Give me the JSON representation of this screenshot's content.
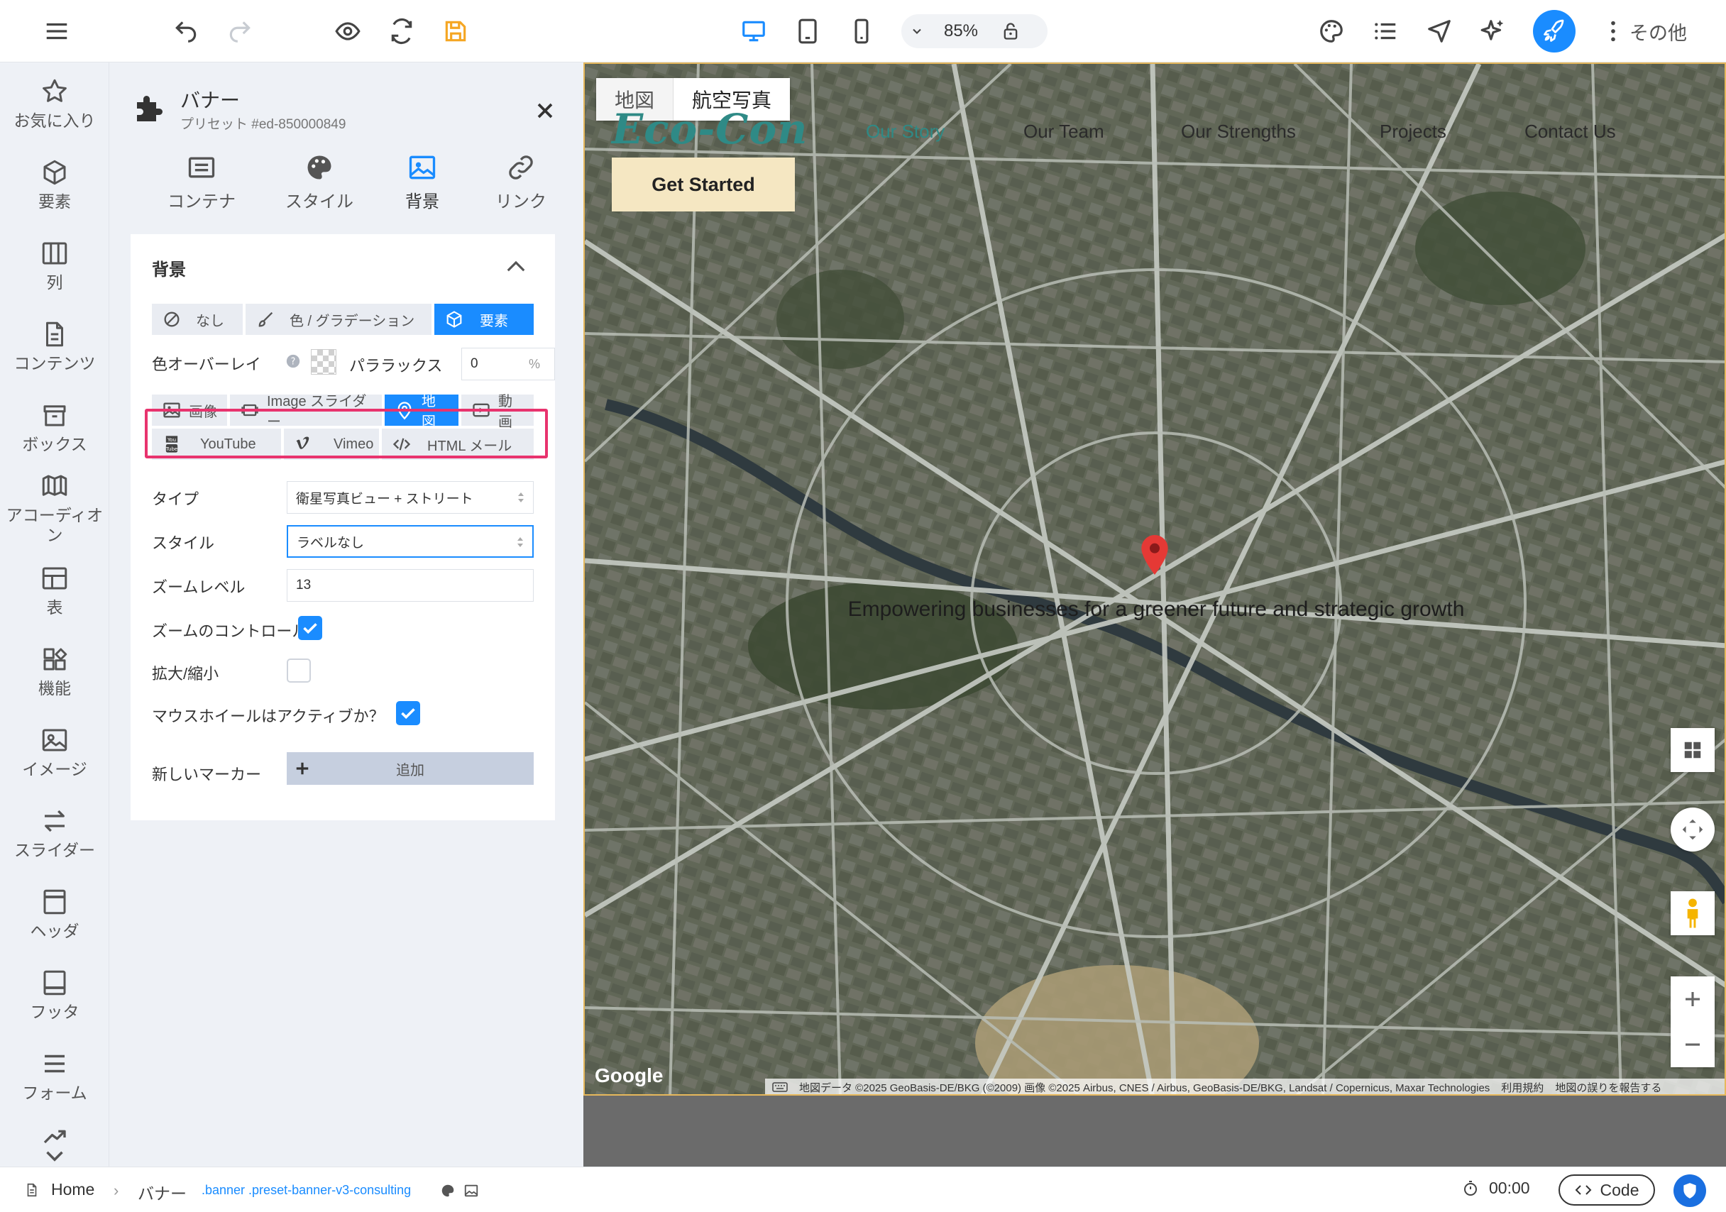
{
  "toolbar": {
    "zoom": "85%",
    "more_label": "その他"
  },
  "rail": {
    "items": [
      {
        "label": "お気に入り"
      },
      {
        "label": "要素"
      },
      {
        "label": "列"
      },
      {
        "label": "コンテンツ"
      },
      {
        "label": "ボックス"
      },
      {
        "label": "アコーディオ",
        "label2": "ン"
      },
      {
        "label": "表"
      },
      {
        "label": "機能"
      },
      {
        "label": "イメージ"
      },
      {
        "label": "スライダー"
      },
      {
        "label": "ヘッダ"
      },
      {
        "label": "フッタ"
      },
      {
        "label": "フォーム"
      }
    ]
  },
  "panel": {
    "title": "バナー",
    "subtitle": "プリセット #ed-850000849",
    "tabs": [
      {
        "label": "コンテナ"
      },
      {
        "label": "スタイル"
      },
      {
        "label": "背景"
      },
      {
        "label": "リンク"
      }
    ],
    "section_title": "背景",
    "bg_modes": [
      {
        "label": "なし"
      },
      {
        "label": "色 / グラデーション"
      },
      {
        "label": "要素"
      }
    ],
    "overlay_label": "色オーバーレイ",
    "parallax_label": "パララックス",
    "parallax_value": "0",
    "parallax_unit": "%",
    "element_types": [
      {
        "label": "画像"
      },
      {
        "label": "Image スライダー"
      },
      {
        "label": "地図"
      },
      {
        "label": "動画"
      },
      {
        "label": "YouTube"
      },
      {
        "label": "Vimeo"
      },
      {
        "label": "HTML メール"
      }
    ],
    "type_label": "タイプ",
    "type_value": "衛星写真ビュー + ストリート",
    "style_label": "スタイル",
    "style_value": "ラベルなし",
    "zoom_label": "ズームレベル",
    "zoom_value": "13",
    "zoom_controls_label": "ズームのコントロール",
    "zoom_controls_checked": true,
    "scale_label": "拡大/縮小",
    "scale_checked": false,
    "mousewheel_label": "マウスホイールはアクティブか？",
    "mousewheel_checked": true,
    "new_marker_label": "新しいマーカー",
    "add_label": "追加"
  },
  "canvas": {
    "map_types": [
      {
        "label": "地図"
      },
      {
        "label": "航空写真"
      }
    ],
    "logo": "Eco-Con",
    "nav": [
      {
        "label": "Our Story"
      },
      {
        "label": "Our Team"
      },
      {
        "label": "Our Strengths"
      },
      {
        "label": "Projects"
      },
      {
        "label": "Contact Us"
      }
    ],
    "cta": "Get Started",
    "tagline": "Empowering businesses for a greener future and strategic growth",
    "google": "Google",
    "attribution": "地図データ ©2025 GeoBasis-DE/BKG (©2009) 画像 ©2025 Airbus, CNES / Airbus, GeoBasis-DE/BKG, Landsat / Copernicus, Maxar Technologies",
    "terms": "利用規約",
    "report": "地図の誤りを報告する"
  },
  "bottom": {
    "home": "Home",
    "crumb": "バナー",
    "classes": ".banner .preset-banner-v3-consulting",
    "time": "00:00",
    "code": "Code"
  },
  "colors": {
    "accent": "#1a8cff",
    "highlight": "#e8336e",
    "logo": "#2f8a86",
    "cta_bg": "#f5e7c2",
    "save_icon": "#f5a623"
  }
}
